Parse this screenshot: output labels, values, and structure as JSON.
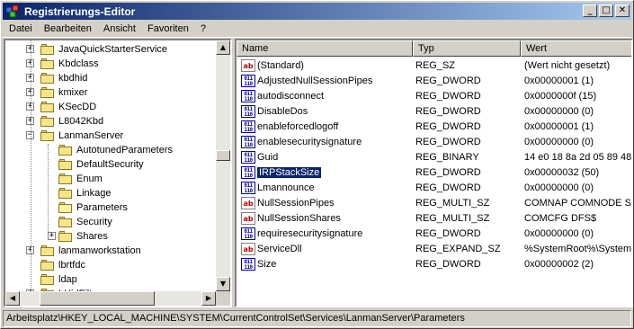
{
  "window": {
    "title": "Registrierungs-Editor",
    "minimize_glyph": "_",
    "maximize_glyph": "□",
    "close_glyph": "✕"
  },
  "menu": {
    "items": [
      {
        "label": "Datei"
      },
      {
        "label": "Bearbeiten"
      },
      {
        "label": "Ansicht"
      },
      {
        "label": "Favoriten"
      },
      {
        "label": "?"
      }
    ]
  },
  "tree": {
    "items": [
      {
        "label": "JavaQuickStarterService",
        "expander": "+",
        "level": 1
      },
      {
        "label": "Kbdclass",
        "expander": "+",
        "level": 1
      },
      {
        "label": "kbdhid",
        "expander": "+",
        "level": 1
      },
      {
        "label": "kmixer",
        "expander": "+",
        "level": 1
      },
      {
        "label": "KSecDD",
        "expander": "+",
        "level": 1
      },
      {
        "label": "L8042Kbd",
        "expander": "+",
        "level": 1
      },
      {
        "label": "LanmanServer",
        "expander": "−",
        "level": 1
      },
      {
        "label": "AutotunedParameters",
        "expander": "",
        "level": 2
      },
      {
        "label": "DefaultSecurity",
        "expander": "",
        "level": 2
      },
      {
        "label": "Enum",
        "expander": "",
        "level": 2
      },
      {
        "label": "Linkage",
        "expander": "",
        "level": 2
      },
      {
        "label": "Parameters",
        "expander": "",
        "level": 2,
        "open": true
      },
      {
        "label": "Security",
        "expander": "",
        "level": 2
      },
      {
        "label": "Shares",
        "expander": "+",
        "level": 2
      },
      {
        "label": "lanmanworkstation",
        "expander": "+",
        "level": 1
      },
      {
        "label": "lbrtfdc",
        "expander": "",
        "level": 1
      },
      {
        "label": "ldap",
        "expander": "",
        "level": 1
      },
      {
        "label": "LHidFilt",
        "expander": "+",
        "level": 1
      }
    ]
  },
  "list": {
    "columns": [
      {
        "label": "Name"
      },
      {
        "label": "Typ"
      },
      {
        "label": "Wert"
      }
    ],
    "rows": [
      {
        "icon": "string",
        "name": "(Standard)",
        "type": "REG_SZ",
        "value": "(Wert nicht gesetzt)"
      },
      {
        "icon": "binary",
        "name": "AdjustedNullSessionPipes",
        "type": "REG_DWORD",
        "value": "0x00000001 (1)"
      },
      {
        "icon": "binary",
        "name": "autodisconnect",
        "type": "REG_DWORD",
        "value": "0x0000000f (15)"
      },
      {
        "icon": "binary",
        "name": "DisableDos",
        "type": "REG_DWORD",
        "value": "0x00000000 (0)"
      },
      {
        "icon": "binary",
        "name": "enableforcedlogoff",
        "type": "REG_DWORD",
        "value": "0x00000001 (1)"
      },
      {
        "icon": "binary",
        "name": "enablesecuritysignature",
        "type": "REG_DWORD",
        "value": "0x00000000 (0)"
      },
      {
        "icon": "binary",
        "name": "Guid",
        "type": "REG_BINARY",
        "value": "14 e0 18 8a 2d 05 89 48"
      },
      {
        "icon": "binary",
        "name": "IRPStackSize",
        "type": "REG_DWORD",
        "value": "0x00000032 (50)",
        "selected": true
      },
      {
        "icon": "binary",
        "name": "Lmannounce",
        "type": "REG_DWORD",
        "value": "0x00000000 (0)"
      },
      {
        "icon": "string",
        "name": "NullSessionPipes",
        "type": "REG_MULTI_SZ",
        "value": "COMNAP COMNODE SQL"
      },
      {
        "icon": "string",
        "name": "NullSessionShares",
        "type": "REG_MULTI_SZ",
        "value": "COMCFG DFS$"
      },
      {
        "icon": "binary",
        "name": "requiresecuritysignature",
        "type": "REG_DWORD",
        "value": "0x00000000 (0)"
      },
      {
        "icon": "string",
        "name": "ServiceDll",
        "type": "REG_EXPAND_SZ",
        "value": "%SystemRoot%\\System"
      },
      {
        "icon": "binary",
        "name": "Size",
        "type": "REG_DWORD",
        "value": "0x00000002 (2)"
      }
    ]
  },
  "icons": {
    "string_glyph": "ab",
    "binary_glyph": "011\n110"
  },
  "status": {
    "path": "Arbeitsplatz\\HKEY_LOCAL_MACHINE\\SYSTEM\\CurrentControlSet\\Services\\LanmanServer\\Parameters"
  },
  "colors": {
    "title_active_start": "#0a246a",
    "title_active_end": "#a6caf0",
    "selection": "#0a246a",
    "face": "#d4d0c8"
  },
  "scroll": {
    "tree_vertical_thumb_position": 0.45,
    "tree_horizontal_thumb_position": 0.3
  }
}
